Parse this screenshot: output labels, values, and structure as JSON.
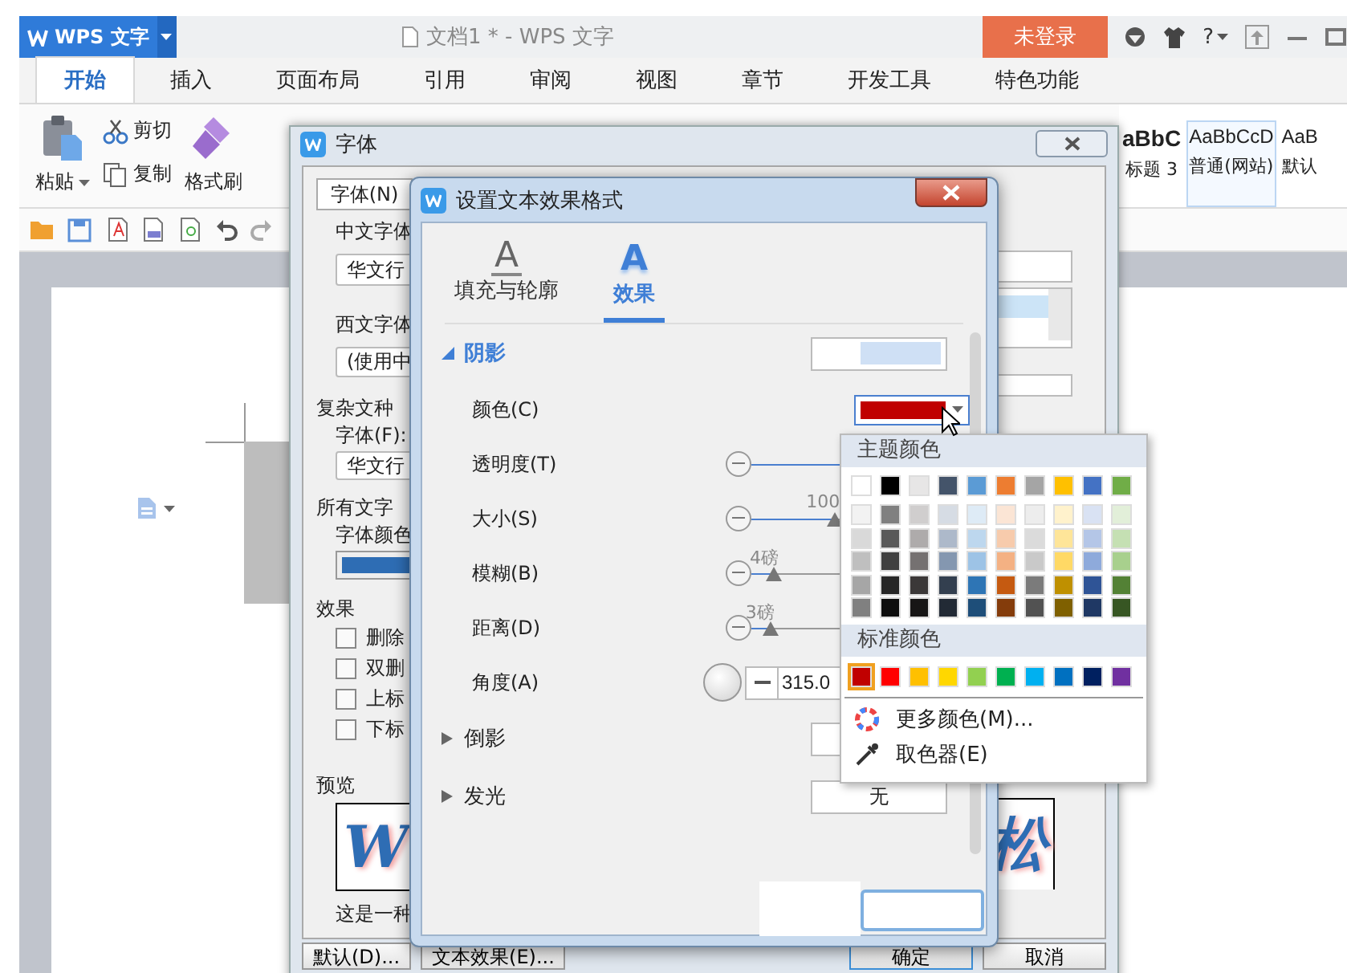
{
  "app": {
    "logo": "WPS 文字",
    "title": "文档1 * - WPS 文字",
    "login_button": "未登录",
    "help": "?"
  },
  "ribbon_tabs": [
    {
      "label": "开始",
      "selected": true
    },
    {
      "label": "插入",
      "selected": false
    },
    {
      "label": "页面布局",
      "selected": false
    },
    {
      "label": "引用",
      "selected": false
    },
    {
      "label": "审阅",
      "selected": false
    },
    {
      "label": "视图",
      "selected": false
    },
    {
      "label": "章节",
      "selected": false
    },
    {
      "label": "开发工具",
      "selected": false
    },
    {
      "label": "特色功能",
      "selected": false
    }
  ],
  "clipboard": {
    "paste": "粘贴",
    "cut": "剪切",
    "copy": "复制",
    "format_painter": "格式刷"
  },
  "styles": [
    {
      "sample": "aBbC",
      "name": "标题 3",
      "kind": "heading",
      "selected": false
    },
    {
      "sample": "AaBbCcD",
      "name": "普通(网站)",
      "kind": "normal",
      "selected": true
    },
    {
      "sample": "AaB",
      "name": "默认",
      "kind": "normal",
      "selected": false
    }
  ],
  "font_dialog": {
    "title": "字体",
    "tab": "字体(N)",
    "chinese_font_label": "中文字体",
    "chinese_font": "华文行",
    "western_font_label": "西文字体",
    "western_font": "(使用中",
    "complex_label": "复杂文种",
    "complex_font_label": "字体(F):",
    "complex_font": "华文行",
    "all_text_label": "所有文字",
    "font_color_label": "字体颜色",
    "effects_label": "效果",
    "effects": [
      {
        "label": "删除",
        "checked": false
      },
      {
        "label": "双删",
        "checked": false
      },
      {
        "label": "上标",
        "checked": false
      },
      {
        "label": "下标",
        "checked": false
      }
    ],
    "preview_label": "预览",
    "preview_left": "W",
    "preview_right": "松",
    "preview_caption": "这是一种",
    "buttons": [
      {
        "label": "默认(D)...",
        "kind": "normal"
      },
      {
        "label": "文本效果(E)...",
        "kind": "normal"
      },
      {
        "label": "确定",
        "kind": "primary"
      },
      {
        "label": "取消",
        "kind": "normal"
      }
    ]
  },
  "effect_dialog": {
    "title": "设置文本效果格式",
    "tabs": [
      {
        "label": "填充与轮廓",
        "icon": "A",
        "kind": "fill",
        "selected": false
      },
      {
        "label": "效果",
        "icon": "A",
        "kind": "effects",
        "selected": true
      }
    ],
    "sections": [
      {
        "label": "阴影",
        "expanded": true,
        "rows": [
          {
            "kind": "color",
            "label": "颜色(C)",
            "color": "#c00000"
          },
          {
            "kind": "slider",
            "label": "透明度(T)",
            "level": 0.6
          },
          {
            "kind": "slider",
            "label": "大小(S)",
            "level": 0.4,
            "reading": "100"
          },
          {
            "kind": "slider",
            "label": "模糊(B)",
            "level": 0.11,
            "reading": "4磅"
          },
          {
            "kind": "slider",
            "label": "距离(D)",
            "level": 0.09,
            "reading": "3磅"
          },
          {
            "kind": "angle",
            "label": "角度(A)",
            "value": "315.0"
          }
        ]
      },
      {
        "label": "倒影",
        "expanded": false
      },
      {
        "label": "发光",
        "expanded": false,
        "preset": "无"
      }
    ]
  },
  "color_popup": {
    "theme_label": "主题颜色",
    "theme_colors": [
      {
        "color": "#ffffff",
        "selected": false
      },
      {
        "color": "#000000",
        "selected": false
      },
      {
        "color": "#e7e6e6",
        "selected": false
      },
      {
        "color": "#44546a",
        "selected": false
      },
      {
        "color": "#5b9bd5",
        "selected": false
      },
      {
        "color": "#ed7d31",
        "selected": false
      },
      {
        "color": "#a5a5a5",
        "selected": false
      },
      {
        "color": "#ffc000",
        "selected": false
      },
      {
        "color": "#4472c4",
        "selected": false
      },
      {
        "color": "#70ad47",
        "selected": false
      }
    ],
    "shades": [
      [
        {
          "color": "#f2f2f2",
          "selected": false
        },
        {
          "color": "#808080",
          "selected": false
        },
        {
          "color": "#d0cece",
          "selected": false
        },
        {
          "color": "#d6dce4",
          "selected": false
        },
        {
          "color": "#deebf6",
          "selected": false
        },
        {
          "color": "#fbe5d5",
          "selected": false
        },
        {
          "color": "#ededed",
          "selected": false
        },
        {
          "color": "#fff2cc",
          "selected": false
        },
        {
          "color": "#d9e2f3",
          "selected": false
        },
        {
          "color": "#e2efd9",
          "selected": false
        }
      ],
      [
        {
          "color": "#d9d9d9",
          "selected": false
        },
        {
          "color": "#595959",
          "selected": false
        },
        {
          "color": "#aeabab",
          "selected": false
        },
        {
          "color": "#adb9ca",
          "selected": false
        },
        {
          "color": "#bdd7ee",
          "selected": false
        },
        {
          "color": "#f7cbac",
          "selected": false
        },
        {
          "color": "#dbdbdb",
          "selected": false
        },
        {
          "color": "#fee599",
          "selected": false
        },
        {
          "color": "#b4c6e7",
          "selected": false
        },
        {
          "color": "#c5e0b3",
          "selected": false
        }
      ],
      [
        {
          "color": "#bfbfbf",
          "selected": false
        },
        {
          "color": "#404040",
          "selected": false
        },
        {
          "color": "#757171",
          "selected": false
        },
        {
          "color": "#8497b0",
          "selected": false
        },
        {
          "color": "#9dc3e6",
          "selected": false
        },
        {
          "color": "#f4b183",
          "selected": false
        },
        {
          "color": "#c9c9c9",
          "selected": false
        },
        {
          "color": "#ffd965",
          "selected": false
        },
        {
          "color": "#8eaadb",
          "selected": false
        },
        {
          "color": "#a8d08d",
          "selected": false
        }
      ],
      [
        {
          "color": "#a6a6a6",
          "selected": false
        },
        {
          "color": "#262626",
          "selected": false
        },
        {
          "color": "#3b3838",
          "selected": false
        },
        {
          "color": "#333f4f",
          "selected": false
        },
        {
          "color": "#2e75b5",
          "selected": false
        },
        {
          "color": "#c55a11",
          "selected": false
        },
        {
          "color": "#7b7b7b",
          "selected": false
        },
        {
          "color": "#bf9000",
          "selected": false
        },
        {
          "color": "#2f5496",
          "selected": false
        },
        {
          "color": "#538135",
          "selected": false
        }
      ],
      [
        {
          "color": "#808080",
          "selected": false
        },
        {
          "color": "#0d0d0d",
          "selected": false
        },
        {
          "color": "#171616",
          "selected": false
        },
        {
          "color": "#222a35",
          "selected": false
        },
        {
          "color": "#1e4e79",
          "selected": false
        },
        {
          "color": "#843c0b",
          "selected": false
        },
        {
          "color": "#525252",
          "selected": false
        },
        {
          "color": "#7f6000",
          "selected": false
        },
        {
          "color": "#1f3864",
          "selected": false
        },
        {
          "color": "#375623",
          "selected": false
        }
      ]
    ],
    "standard_label": "标准颜色",
    "standard_colors": [
      {
        "color": "#c00000",
        "selected": true
      },
      {
        "color": "#ff0000",
        "selected": false
      },
      {
        "color": "#ffc000",
        "selected": false
      },
      {
        "color": "#ffd700",
        "selected": false
      },
      {
        "color": "#92d050",
        "selected": false
      },
      {
        "color": "#00b050",
        "selected": false
      },
      {
        "color": "#00b0f0",
        "selected": false
      },
      {
        "color": "#0070c0",
        "selected": false
      },
      {
        "color": "#002060",
        "selected": false
      },
      {
        "color": "#7030a0",
        "selected": false
      }
    ],
    "more_colors": "更多颜色(M)...",
    "eyedropper": "取色器(E)"
  }
}
